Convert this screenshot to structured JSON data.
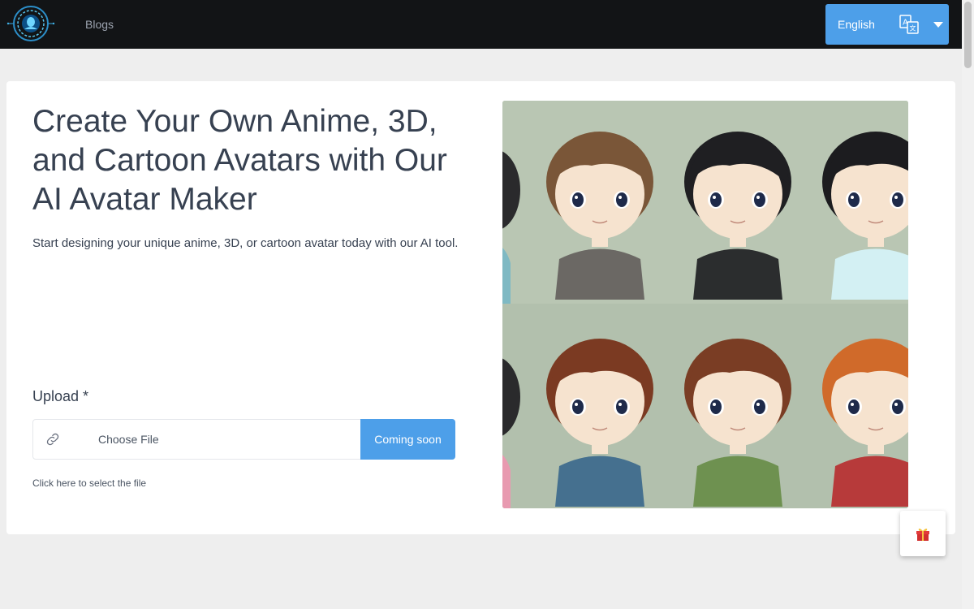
{
  "nav": {
    "blogs_label": "Blogs",
    "language_label": "English"
  },
  "hero": {
    "title": "Create Your Own Anime, 3D, and Cartoon Avatars with Our AI Avatar Maker",
    "subtitle": "Start designing your unique anime, 3D, or cartoon avatar today with our AI tool."
  },
  "upload": {
    "label": "Upload *",
    "choose_text": "Choose File",
    "button_label": "Coming soon",
    "hint": "Click here to select the file"
  },
  "icons": {
    "logo": "logo-icon",
    "translate": "translate-icon",
    "caret": "chevron-down-icon",
    "link": "link-icon",
    "gift": "gift-icon"
  },
  "colors": {
    "navbar_bg": "#121416",
    "accent": "#4d9fe9",
    "page_bg": "#eeeeee",
    "card_bg": "#ffffff",
    "illustration_bg": "#b6c3b0"
  },
  "avatars": [
    {
      "hair": "#7a5638",
      "shirt": "#6b6864"
    },
    {
      "hair": "#1f1f22",
      "shirt": "#2b2d2e"
    },
    {
      "hair": "#1c1c1f",
      "shirt": "#d3f0f3"
    },
    {
      "hair": "#7b3a22",
      "shirt": "#45708f"
    },
    {
      "hair": "#7a3d24",
      "shirt": "#6e9150"
    },
    {
      "hair": "#d06a2a",
      "shirt": "#b73a3a"
    }
  ]
}
